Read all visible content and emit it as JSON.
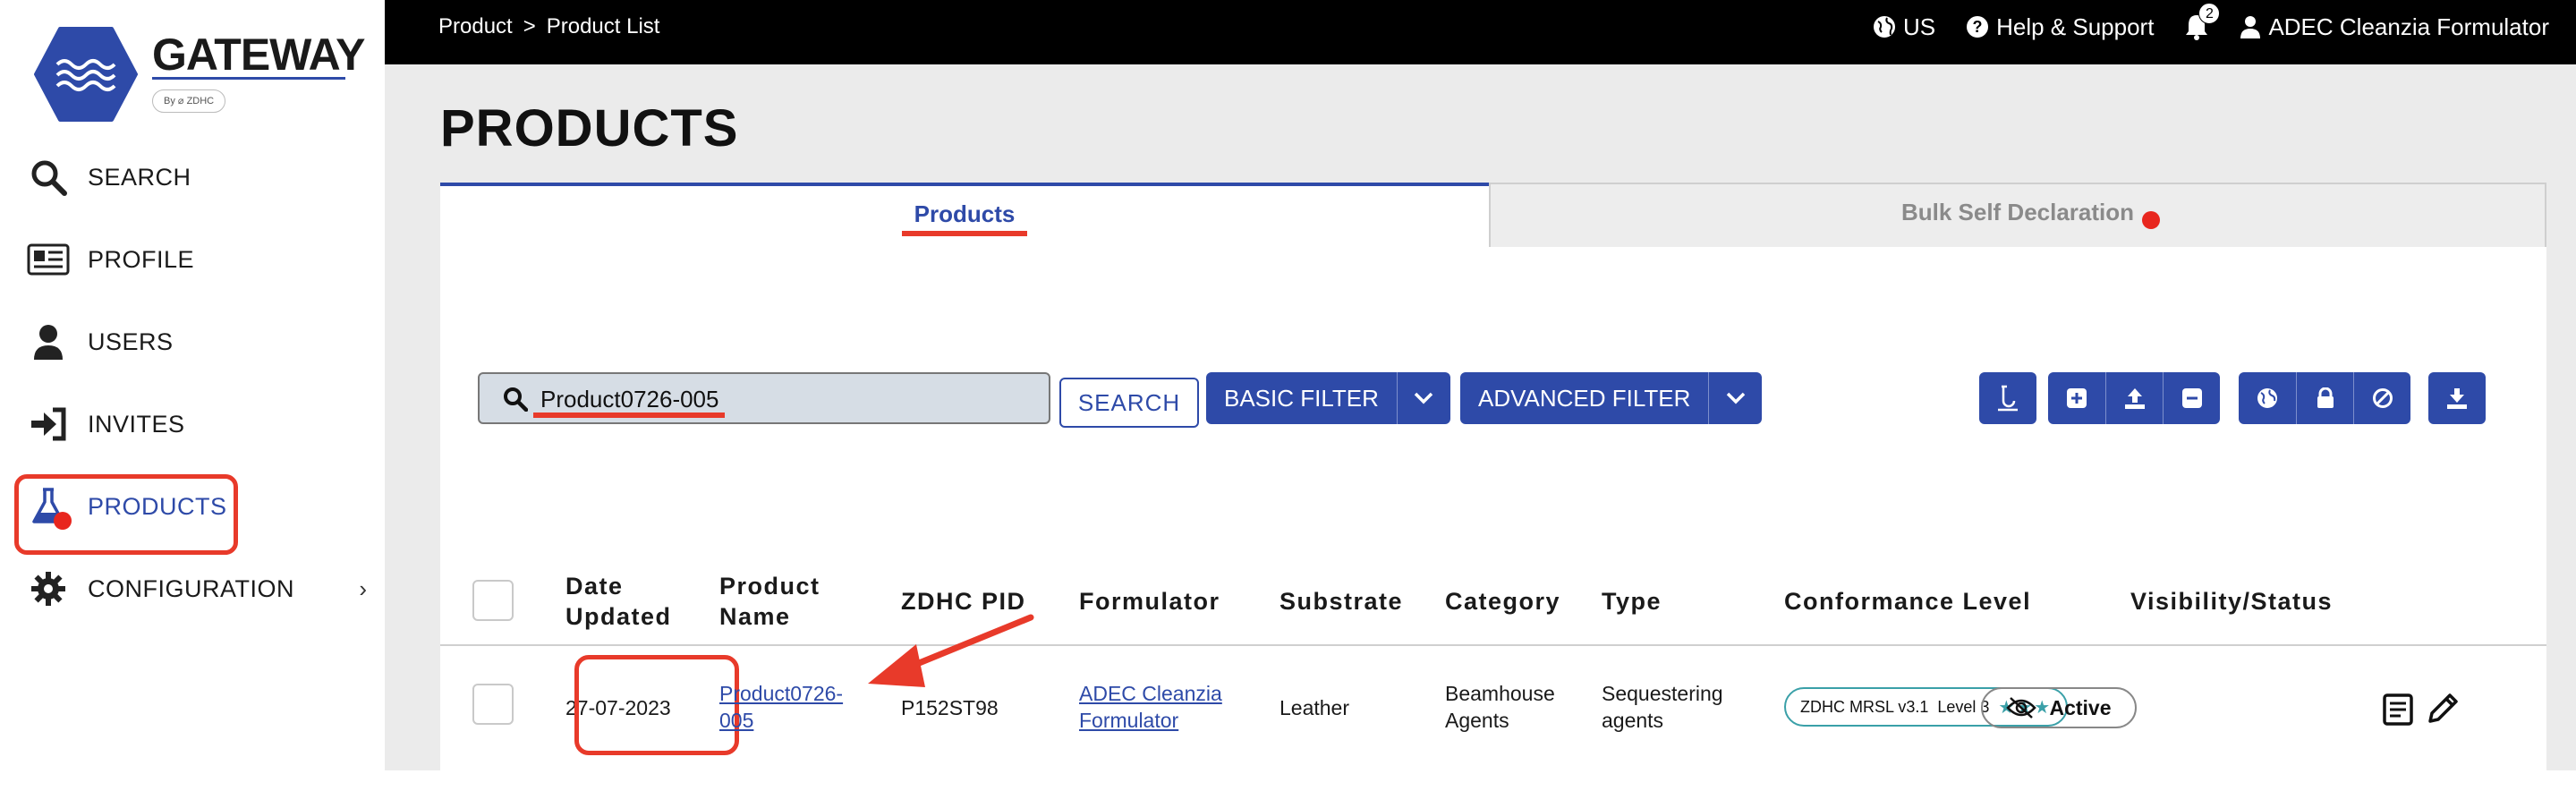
{
  "brand": {
    "name": "GATEWAY",
    "byline": "By ⌀ ZDHC",
    "color": "#2e4aa8"
  },
  "sidebar": {
    "items": [
      {
        "label": "SEARCH",
        "icon": "search-icon"
      },
      {
        "label": "PROFILE",
        "icon": "profile-card-icon"
      },
      {
        "label": "USERS",
        "icon": "user-icon"
      },
      {
        "label": "INVITES",
        "icon": "sign-in-icon"
      },
      {
        "label": "PRODUCTS",
        "icon": "flask-icon",
        "active": true
      },
      {
        "label": "CONFIGURATION",
        "icon": "gear-icon",
        "chevron": "›"
      }
    ]
  },
  "topbar": {
    "breadcrumb": [
      "Product",
      "Product List"
    ],
    "breadcrumb_sep": ">",
    "language": "US",
    "help": "Help & Support",
    "notifications_count": "2",
    "user": "ADEC Cleanzia Formulator"
  },
  "page": {
    "title": "PRODUCTS",
    "tabs": [
      {
        "label": "Products",
        "active": true
      },
      {
        "label": "Bulk Self Declaration",
        "active": false
      }
    ]
  },
  "filters": {
    "search_value": "Product0726-005",
    "search_button": "SEARCH",
    "basic_filter": "BASIC FILTER",
    "advanced_filter": "ADVANCED FILTER",
    "action_icons": [
      "lab-icon",
      "plus-icon",
      "upload-icon",
      "minus-icon",
      "globe-icon",
      "lock-icon",
      "block-icon",
      "download-icon"
    ]
  },
  "table": {
    "headers": {
      "date": "Date Updated",
      "name": "Product Name",
      "pid": "ZDHC PID",
      "formulator": "Formulator",
      "substrate": "Substrate",
      "category": "Category",
      "type": "Type",
      "conformance": "Conformance Level",
      "visibility": "Visibility/Status"
    },
    "rows": [
      {
        "date": "27-07-2023",
        "name": "Product0726-005",
        "pid": "P152ST98",
        "formulator": "ADEC Cleanzia Formulator",
        "substrate": "Leather",
        "category": "Beamhouse Agents",
        "type": "Sequestering agents",
        "conformance_standard": "ZDHC MRSL v3.1",
        "conformance_level": "Level 3",
        "conformance_stars": 3,
        "status": "Active"
      }
    ]
  },
  "annotation_color": "#e83a2a"
}
